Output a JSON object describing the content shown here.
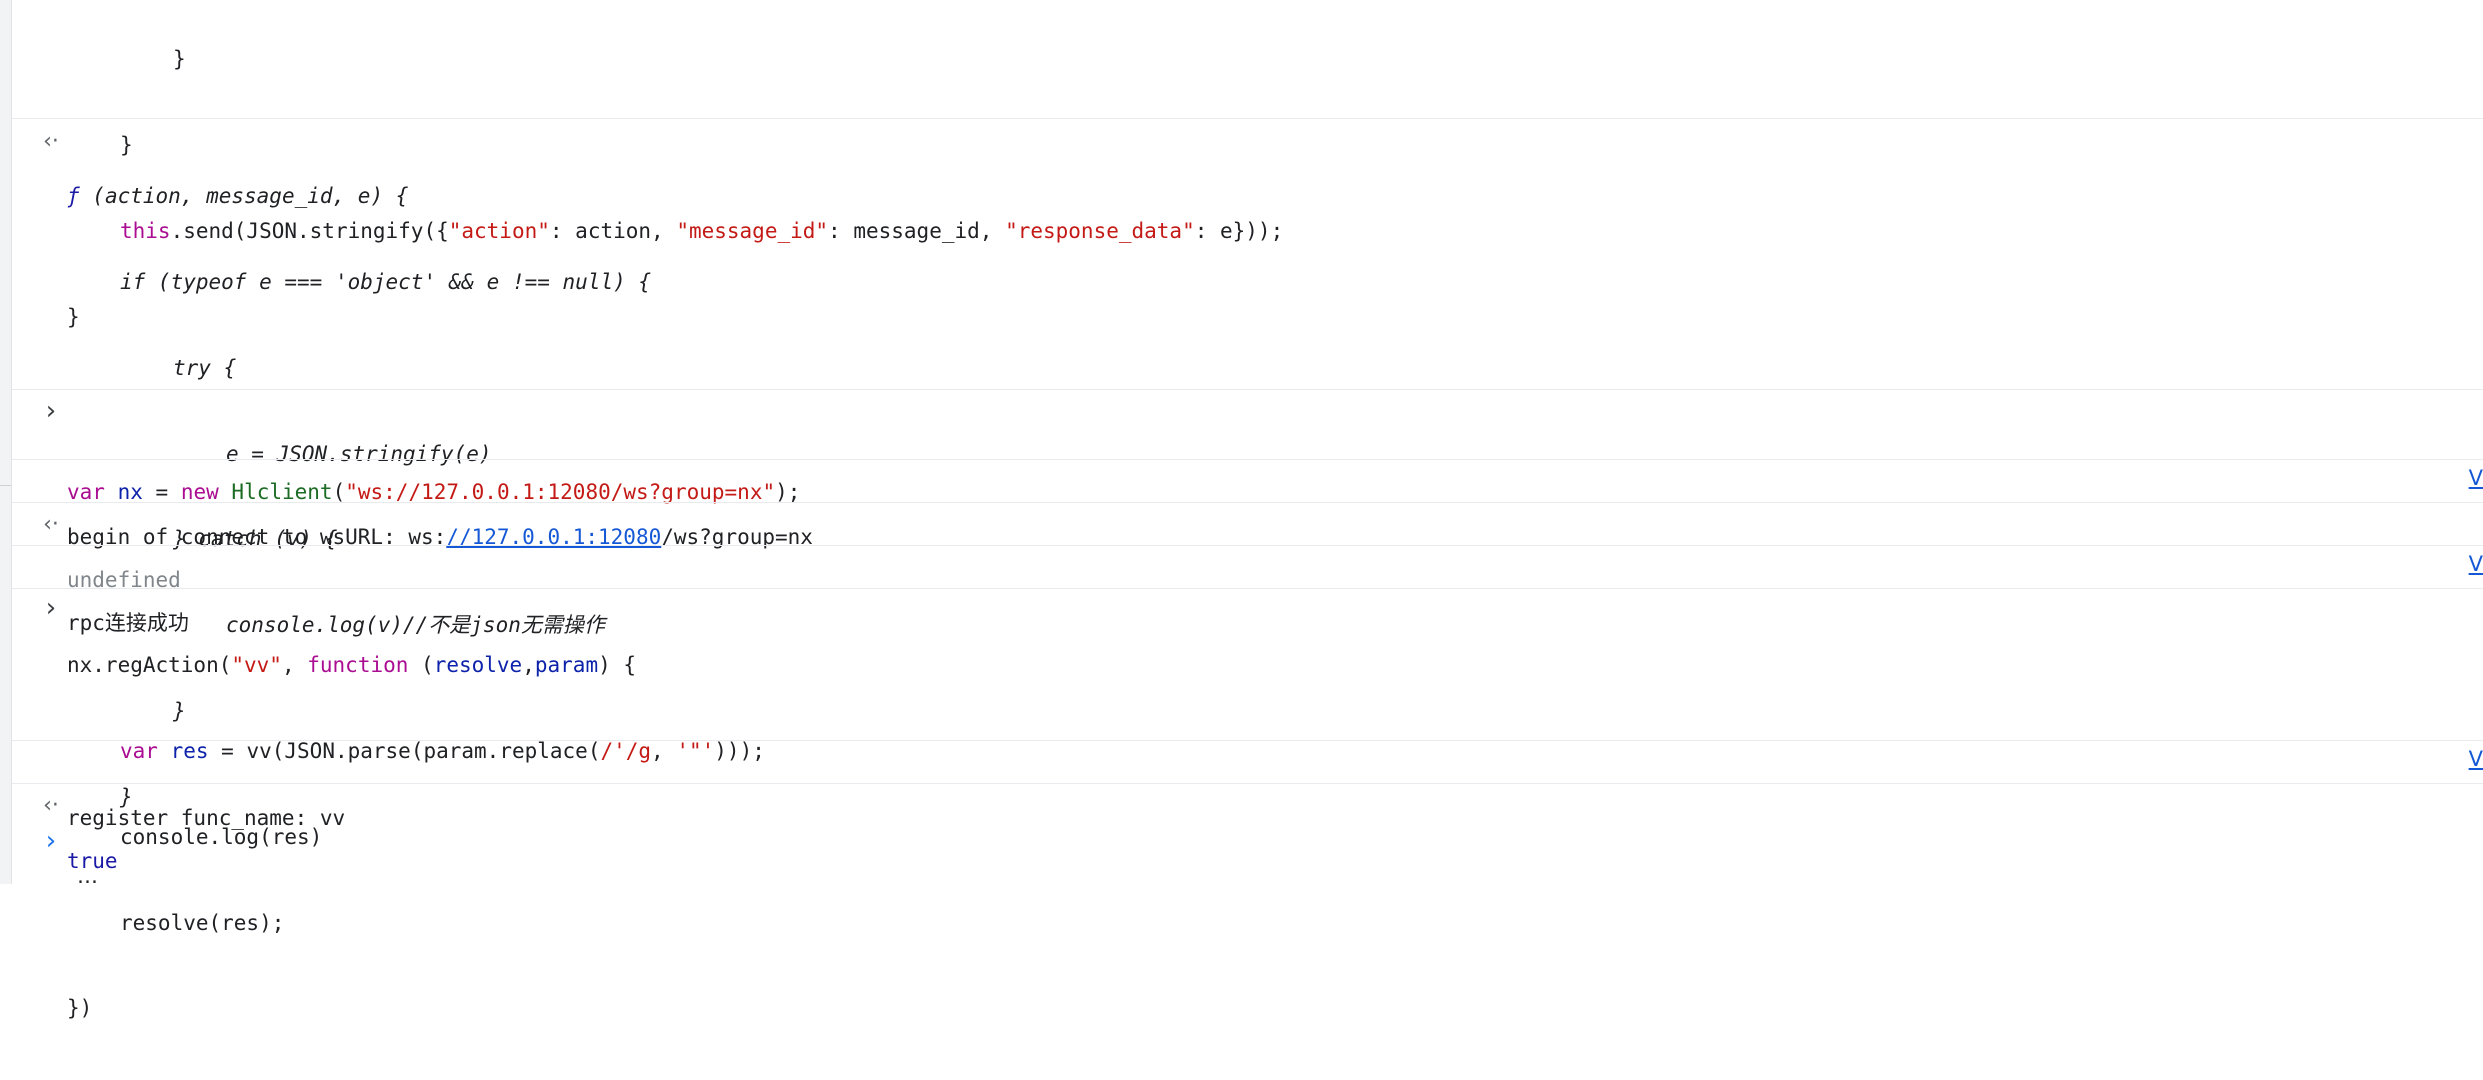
{
  "entries": {
    "top_code": {
      "l1": "}",
      "l2": "}",
      "l3_this": "this",
      "l3_a": ".send(JSON.stringify({",
      "l3_s1": "\"action\"",
      "l3_b": ": action, ",
      "l3_s2": "\"message_id\"",
      "l3_c": ": message_id, ",
      "l3_s3": "\"response_data\"",
      "l3_d": ": e}));",
      "l4": "}"
    },
    "fn_result": {
      "l1_f": "ƒ",
      "l1_rest": " (action, message_id, e) {",
      "l2_a": "if (typeof e === ",
      "l2_s": "'object'",
      "l2_b": " && e !== null) {",
      "l3": "try {",
      "l4": "e = JSON.stringify(e)",
      "l5": "} catch (v) {",
      "l6": "console.log(v)//不是json无需操作",
      "l7": "}",
      "l8": "}",
      "ellipsis": "…"
    },
    "cmd1": {
      "var_kw": "var",
      "var_name": "nx",
      "eq": " = ",
      "new_kw": "new",
      "cls": "Hlclient",
      "open": "(",
      "url": "\"ws://127.0.0.1:12080/ws?group=nx\"",
      "close": ");"
    },
    "log1": {
      "prefix": "begin of connect to wsURL: ws:",
      "link": "//127.0.0.1:12080",
      "suffix": "/ws?group=nx",
      "source": "V"
    },
    "result1": {
      "value": "undefined"
    },
    "log2": {
      "text": "rpc连接成功",
      "source": "V"
    },
    "cmd2": {
      "l1_a": "nx.regAction(",
      "l1_s": "\"vv\"",
      "l1_b": ", ",
      "l1_fn": "function",
      "l1_c": " (",
      "l1_p1": "resolve",
      "l1_d": ",",
      "l1_p2": "param",
      "l1_e": ") {",
      "l2_var": "var",
      "l2_name": "res",
      "l2_a": " = vv(JSON.parse(param.replace(",
      "l2_re": "/'/g",
      "l2_b": ", ",
      "l2_s": "'\"'",
      "l2_c": ")));",
      "l3": "console.log(res)",
      "l4": "resolve(res);",
      "l5": "})"
    },
    "log3": {
      "text": "register func_name: vv",
      "source": "V"
    },
    "result2": {
      "value": "true"
    }
  },
  "icons": {
    "result_arrow": "‹·",
    "input_arrow": "›",
    "prompt_arrow": "›"
  }
}
